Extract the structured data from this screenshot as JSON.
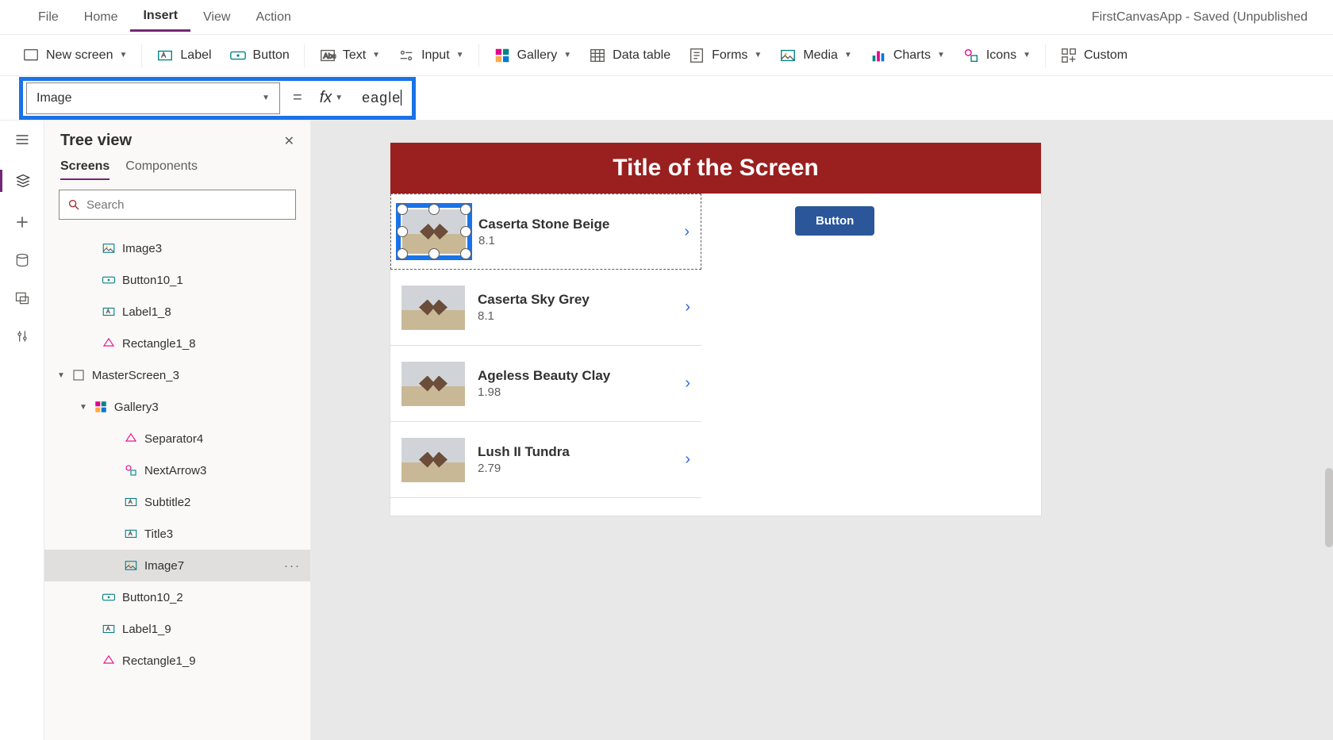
{
  "app_title": "FirstCanvasApp - Saved (Unpublished",
  "menubar": [
    "File",
    "Home",
    "Insert",
    "View",
    "Action"
  ],
  "menubar_active": 2,
  "ribbon": {
    "new_screen": "New screen",
    "label": "Label",
    "button": "Button",
    "text": "Text",
    "input": "Input",
    "gallery": "Gallery",
    "data_table": "Data table",
    "forms": "Forms",
    "media": "Media",
    "charts": "Charts",
    "icons": "Icons",
    "custom": "Custom"
  },
  "formula": {
    "property": "Image",
    "value": "eagle"
  },
  "tree": {
    "title": "Tree view",
    "tabs": [
      "Screens",
      "Components"
    ],
    "active_tab": 0,
    "search_placeholder": "Search",
    "nodes": [
      {
        "label": "Image3",
        "icon": "image",
        "indent": 1
      },
      {
        "label": "Button10_1",
        "icon": "button",
        "indent": 1
      },
      {
        "label": "Label1_8",
        "icon": "label",
        "indent": 1
      },
      {
        "label": "Rectangle1_8",
        "icon": "rect",
        "indent": 1
      },
      {
        "label": "MasterScreen_3",
        "icon": "screen",
        "indent": 0,
        "expand": true
      },
      {
        "label": "Gallery3",
        "icon": "gallery",
        "indent": 1,
        "expand": true
      },
      {
        "label": "Separator4",
        "icon": "rect",
        "indent": 2
      },
      {
        "label": "NextArrow3",
        "icon": "iconctl",
        "indent": 2
      },
      {
        "label": "Subtitle2",
        "icon": "label",
        "indent": 2
      },
      {
        "label": "Title3",
        "icon": "label",
        "indent": 2
      },
      {
        "label": "Image7",
        "icon": "image",
        "indent": 2,
        "selected": true
      },
      {
        "label": "Button10_2",
        "icon": "button",
        "indent": 1
      },
      {
        "label": "Label1_9",
        "icon": "label",
        "indent": 1
      },
      {
        "label": "Rectangle1_9",
        "icon": "rect",
        "indent": 1
      }
    ]
  },
  "canvas": {
    "screen_title": "Title of the Screen",
    "button_label": "Button",
    "gallery": [
      {
        "title": "Caserta Stone Beige",
        "sub": "8.1"
      },
      {
        "title": "Caserta Sky Grey",
        "sub": "8.1"
      },
      {
        "title": "Ageless Beauty Clay",
        "sub": "1.98"
      },
      {
        "title": "Lush II Tundra",
        "sub": "2.79"
      }
    ]
  }
}
